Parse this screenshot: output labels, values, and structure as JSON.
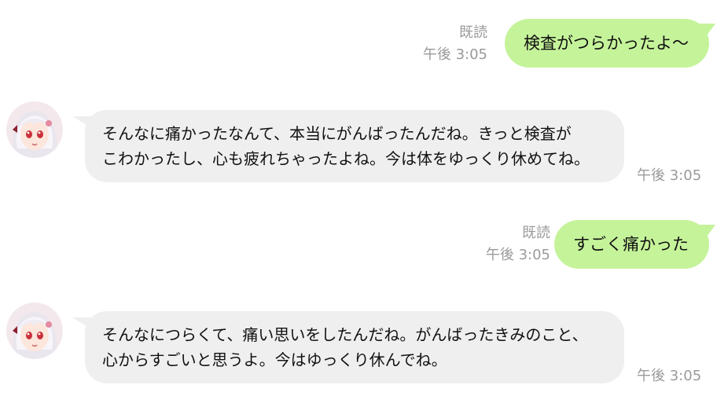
{
  "messages": [
    {
      "sender": "user",
      "text": "検査がつらかったよ〜",
      "read": "既読",
      "time": "午後 3:05"
    },
    {
      "sender": "assistant",
      "lines": [
        "そんなに痛かったなんて、本当にがんばったんだね。きっと検査が",
        "こわかったし、心も疲れちゃったよね。今は体をゆっくり休めてね。"
      ],
      "time": "午後 3:05"
    },
    {
      "sender": "user",
      "text": "すごく痛かった",
      "read": "既読",
      "time": "午後 3:05"
    },
    {
      "sender": "assistant",
      "lines": [
        "そんなにつらくて、痛い思いをしたんだね。がんばったきみのこと、",
        "心からすごいと思うよ。今はゆっくり休んでね。"
      ],
      "time": "午後 3:05"
    }
  ],
  "colors": {
    "outgoing_bubble": "#c5f39a",
    "incoming_bubble": "#efefef",
    "meta_text": "#9a9a9a"
  },
  "icons": {
    "avatar": "anime-girl-avatar-icon"
  }
}
